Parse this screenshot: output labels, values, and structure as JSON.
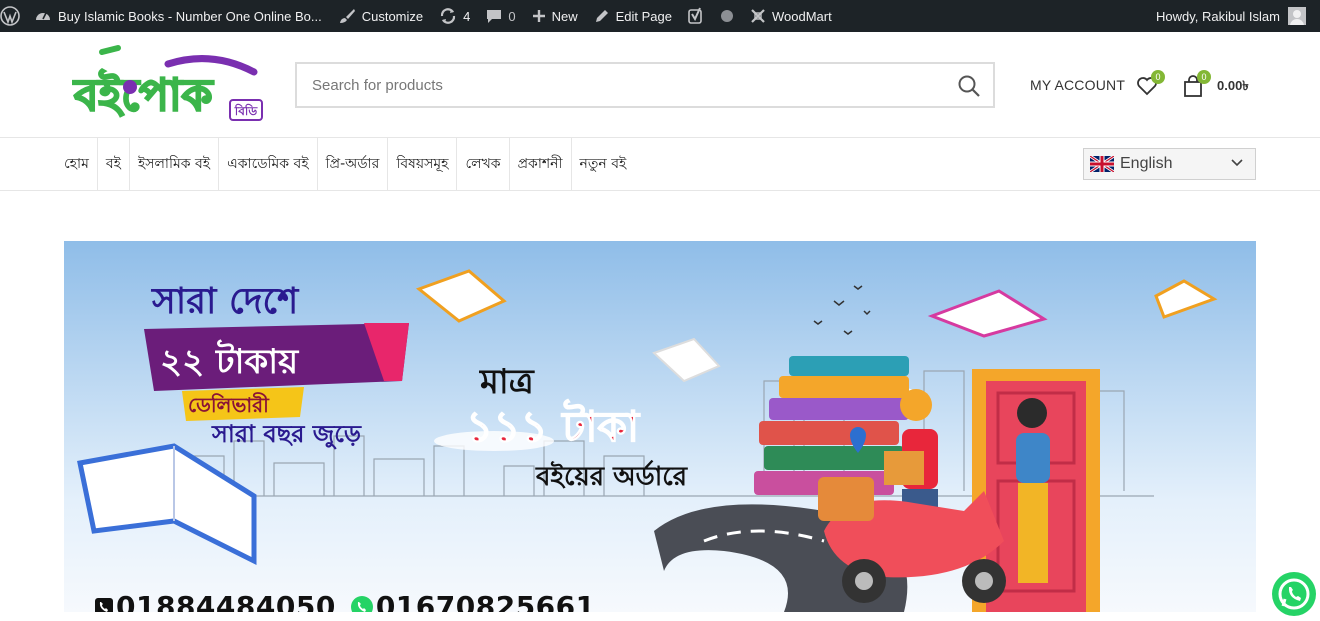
{
  "adminbar": {
    "site_title": "Buy Islamic Books - Number One Online Bo...",
    "customize": "Customize",
    "updates_count": "4",
    "comments_count": "0",
    "new": "New",
    "edit_page": "Edit Page",
    "theme": "WoodMart",
    "greeting": "Howdy, Rakibul Islam"
  },
  "header": {
    "logo_alt": "বইপোক বিডি",
    "logo_text": "বইপোক",
    "logo_sub": "বিডি",
    "search_placeholder": "Search for products",
    "account": "MY ACCOUNT",
    "wishlist_count": "0",
    "cart_count": "0",
    "cart_total": "0.00৳"
  },
  "nav": {
    "items": [
      {
        "label": "হোম"
      },
      {
        "label": "বই"
      },
      {
        "label": "ইসলামিক বই"
      },
      {
        "label": "একাডেমিক বই"
      },
      {
        "label": "প্রি-অর্ডার"
      },
      {
        "label": "বিষয়সমূহ"
      },
      {
        "label": "লেখক"
      },
      {
        "label": "প্রকাশনী"
      },
      {
        "label": "নতুন বই"
      }
    ],
    "language": "English"
  },
  "banner": {
    "line1": "সারা দেশে",
    "line2": "২২ টাকায়",
    "line3": "ডেলিভারী",
    "line4": "সারা বছর জুড়ে",
    "offer_top": "মাত্র",
    "offer_price": "১১১ টাকা",
    "offer_bottom": "বইয়ের অর্ডারে",
    "phone1": "01884484050",
    "phone2": "01670825661"
  },
  "colors": {
    "adminbar_bg": "#1d2327",
    "brand_green": "#3bb54a",
    "brand_purple": "#7a2fb0",
    "badge_green": "#83b735",
    "banner_sky": "#a9cdee",
    "offer_red": "#e8263b"
  },
  "icons": [
    "wordpress-icon",
    "dashboard-icon",
    "brush-icon",
    "refresh-icon",
    "comment-icon",
    "plus-icon",
    "pencil-icon",
    "yoast-icon",
    "circle-icon",
    "woodmart-icon",
    "search-icon",
    "heart-icon",
    "bag-icon",
    "uk-flag-icon",
    "chevron-down-icon",
    "whatsapp-icon",
    "phone-icon"
  ]
}
